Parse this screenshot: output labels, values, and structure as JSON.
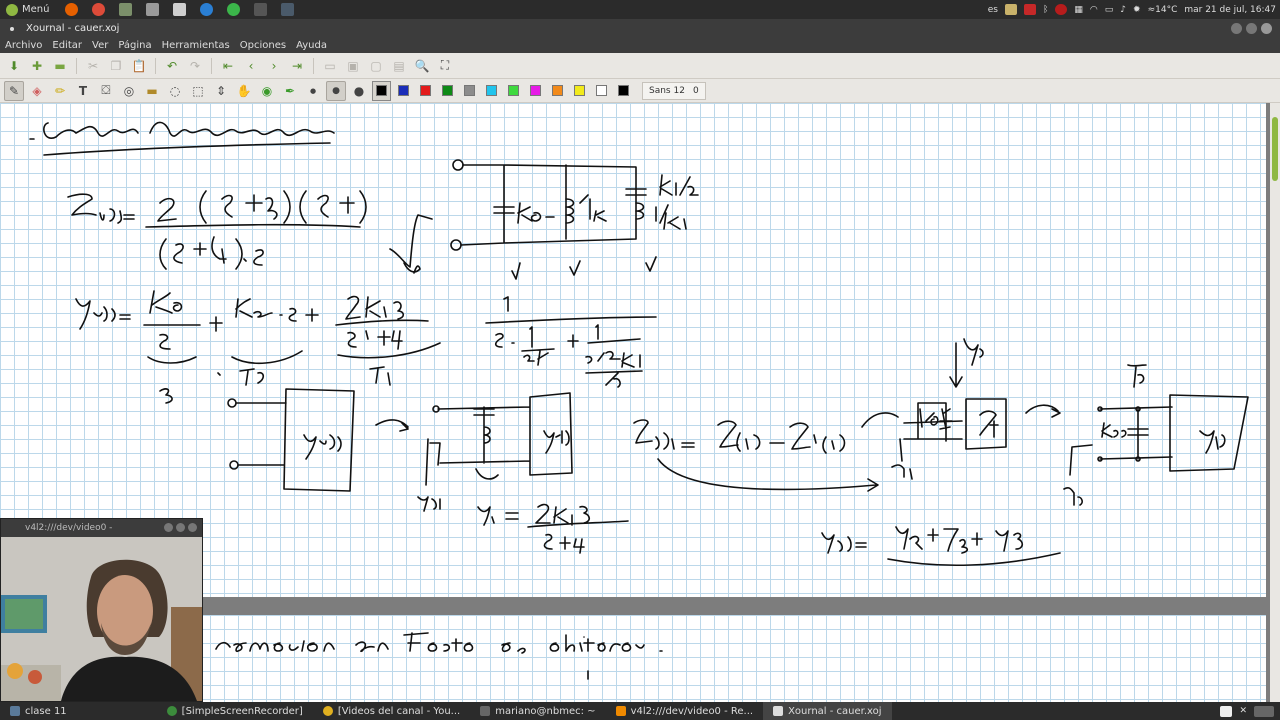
{
  "system_panel": {
    "menu_label": "Menú",
    "tray": {
      "keyboard_layout": "es",
      "weather": "≈14°C",
      "clock": "mar 21 de jul, 16:47"
    }
  },
  "window": {
    "title": "Xournal - cauer.xoj",
    "menus": [
      "Archivo",
      "Editar",
      "Ver",
      "Página",
      "Herramientas",
      "Opciones",
      "Ayuda"
    ]
  },
  "toolbar": {
    "font_name": "Sans 12",
    "font_extra": "0",
    "colors": [
      "#000000",
      "#1a2db8",
      "#e31b1b",
      "#0e8a16",
      "#8c8c8c",
      "#21c4ec",
      "#3fd93f",
      "#e61be6",
      "#f28a1a",
      "#f2ea1b",
      "#ffffff",
      "#000000"
    ]
  },
  "webcam": {
    "title": "v4l2:///dev/video0 -"
  },
  "taskbar": {
    "items": [
      "clase 11",
      "[SimpleScreenRecorder]",
      "[Videos del canal - You...",
      "mariano@nbmec: ~",
      "v4l2:///dev/video0 - Re...",
      "Xournal - cauer.xoj"
    ]
  },
  "colors": {
    "grid": "#bcd8ea",
    "accent": "#8fb842",
    "panel": "#2b2b2b"
  }
}
